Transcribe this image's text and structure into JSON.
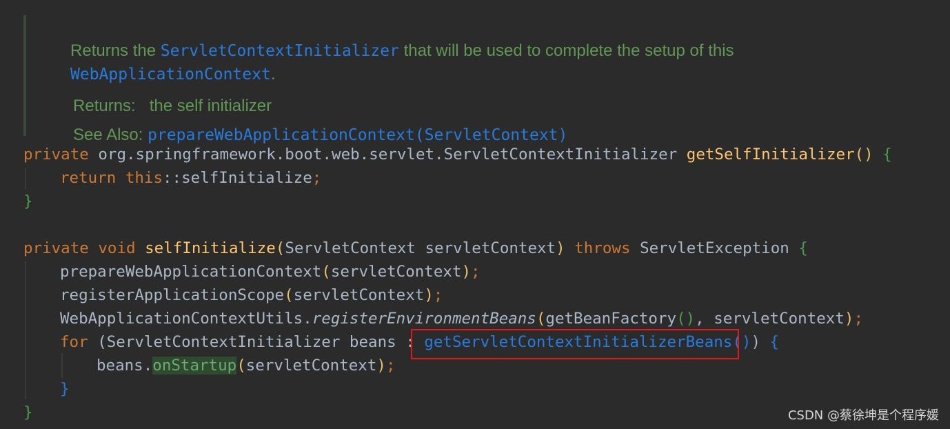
{
  "doc": {
    "line1_prefix": "Returns the ",
    "line1_code": "ServletContextInitializer",
    "line1_suffix": " that will be used to complete the setup of this",
    "line2_code": "WebApplicationContext",
    "line2_suffix": ".",
    "returns_label": "Returns:",
    "returns_text": "the self initializer",
    "see_also_label": "See Also:",
    "see_also_link": "prepareWebApplicationContext(ServletContext)"
  },
  "code": {
    "l1": {
      "kw": "private",
      "type": " org.springframework.boot.web.servlet.ServletContextInitializer ",
      "fn": "getSelfInitializer",
      "parens": "()",
      "brace": " {"
    },
    "l2": {
      "kw_return": "return ",
      "kw_this": "this",
      "rest": "::selfInitialize",
      "semi": ";"
    },
    "l3": {
      "brace": "}"
    },
    "l5": {
      "kw": "private void ",
      "fn": "selfInitialize",
      "open": "(",
      "params": "ServletContext servletContext",
      "close": ")",
      "throws": " throws ",
      "exc": "ServletException",
      "brace": " {"
    },
    "l6": {
      "call": "prepareWebApplicationContext",
      "open": "(",
      "arg": "servletContext",
      "close": ")",
      "semi": ";"
    },
    "l7": {
      "call": "registerApplicationScope",
      "open": "(",
      "arg": "servletContext",
      "close": ")",
      "semi": ";"
    },
    "l8": {
      "cls": "WebApplicationContextUtils.",
      "method": "registerEnvironmentBeans",
      "open": "(",
      "arg1": "getBeanFactory",
      "arg1p": "()",
      "sep": ", servletContext",
      "close": ")",
      "semi": ";"
    },
    "l9": {
      "kw": "for ",
      "open": "(",
      "decl": "ServletContextInitializer beans : ",
      "call": "getServletContextInitializerBeans",
      "callp": "()",
      "close": ")",
      "brace": " {"
    },
    "l10": {
      "obj": "beans.",
      "method": "onStartup",
      "open": "(",
      "arg": "servletContext",
      "close": ")",
      "semi": ";"
    },
    "l11": {
      "brace": "}"
    },
    "l12": {
      "brace": "}"
    }
  },
  "watermark": "CSDN @蔡徐坤是个程序媛",
  "colors": {
    "background": "#2b2b2b",
    "keyword": "#cc7832",
    "function": "#ffc66d",
    "doc_comment": "#629755",
    "doc_link": "#287bde",
    "highlight_box": "#e0191e"
  }
}
